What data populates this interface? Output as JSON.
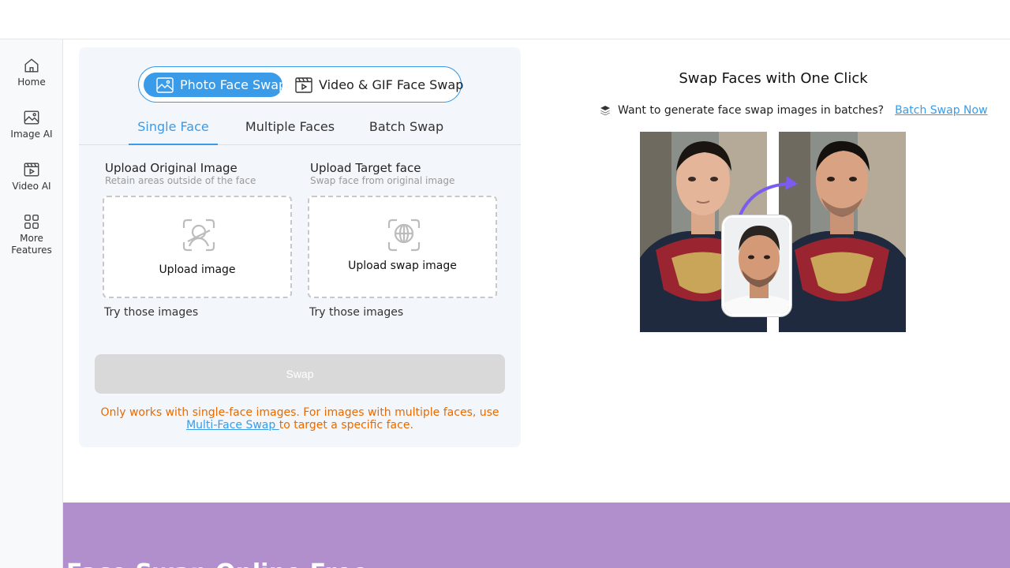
{
  "sidebar": {
    "items": [
      {
        "label": "Home",
        "icon": "home-icon"
      },
      {
        "label": "Image AI",
        "icon": "image-icon"
      },
      {
        "label": "Video AI",
        "icon": "video-icon"
      },
      {
        "label": "More Features",
        "icon": "grid-icon"
      }
    ]
  },
  "mode_toggle": {
    "photo_label": "Photo Face Swap",
    "video_label": "Video & GIF Face Swap"
  },
  "tabs": [
    {
      "label": "Single Face",
      "active": true
    },
    {
      "label": "Multiple Faces",
      "active": false
    },
    {
      "label": "Batch Swap",
      "active": false
    }
  ],
  "upload_original": {
    "title": "Upload Original Image",
    "subtitle": "Retain areas outside of the face",
    "button_label": "Upload image",
    "try_label": "Try those images"
  },
  "upload_target": {
    "title": "Upload Target face",
    "subtitle": "Swap face from original image",
    "button_label": "Upload swap image",
    "try_label": "Try those images"
  },
  "swap_button": "Swap",
  "notice": {
    "text_before": "Only works with single-face images. For images with multiple faces, use ",
    "link_text": "Multi-Face Swap ",
    "text_after": "to target a specific face."
  },
  "showcase": {
    "title": "Swap Faces with One Click",
    "batch_prompt": "Want to generate face swap images in batches?",
    "batch_link": "Batch Swap Now"
  },
  "footer": {
    "heading": "Face Swap Online Free"
  },
  "colors": {
    "accent": "#3a9be8",
    "warning": "#e86a00",
    "footer_band": "#b08fcc",
    "panel_bg": "#f3f7fb"
  }
}
